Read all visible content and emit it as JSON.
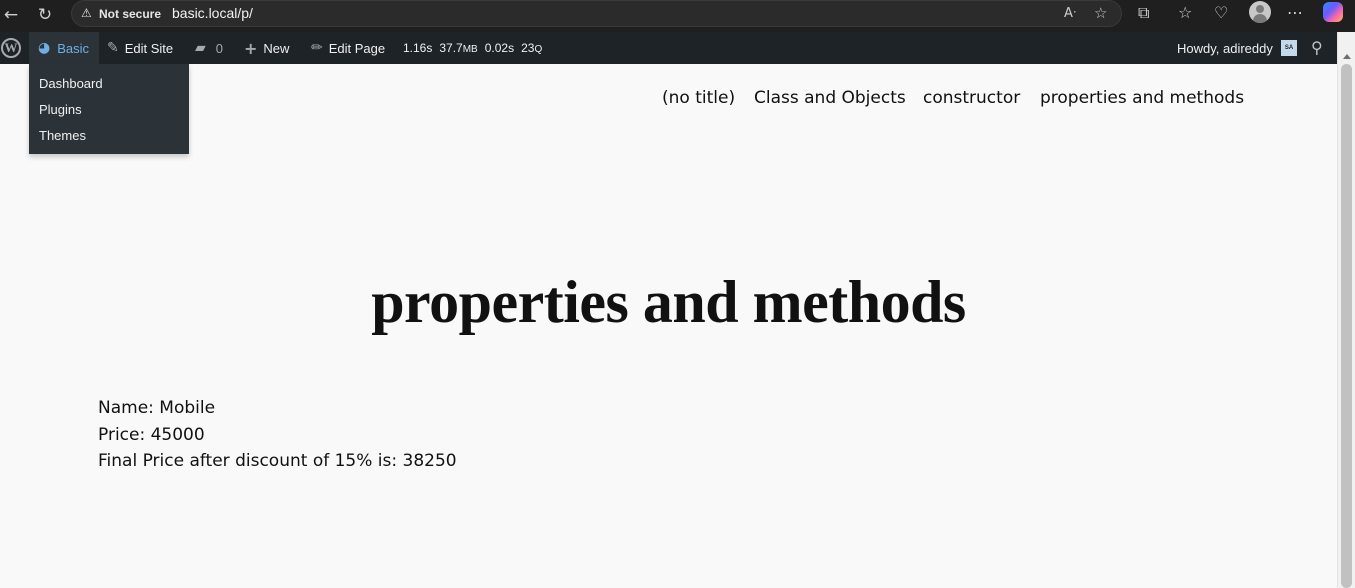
{
  "browser": {
    "address": {
      "security_label": "Not secure",
      "url": "basic.local/p/"
    }
  },
  "admin_bar": {
    "site_name": "Basic",
    "edit_site": "Edit Site",
    "comments_count": "0",
    "new_label": "New",
    "edit_page": "Edit Page",
    "stats": {
      "time": "1.16s",
      "memory_value": "37.7",
      "memory_unit": "MB",
      "query_time": "0.02s",
      "query_count": "23",
      "query_unit": "Q"
    },
    "howdy": "Howdy, adireddy",
    "avatar_initials": "SA"
  },
  "site_menu": {
    "items": [
      "Dashboard",
      "Plugins",
      "Themes"
    ]
  },
  "nav": {
    "items": [
      "(no title)",
      "Class and Objects",
      "constructor",
      "properties and methods"
    ]
  },
  "page": {
    "title": "properties and methods",
    "lines": [
      "Name: Mobile",
      "Price: 45000",
      "Final Price after discount of 15% is: 38250"
    ]
  }
}
